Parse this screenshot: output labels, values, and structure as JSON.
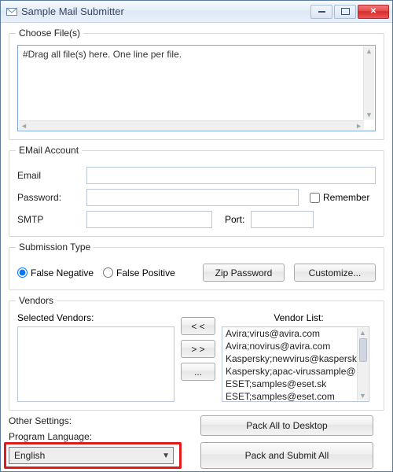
{
  "window": {
    "title": "Sample Mail Submitter"
  },
  "files": {
    "legend": "Choose File(s)",
    "placeholder": "#Drag all file(s) here. One line per file."
  },
  "email_account": {
    "legend": "EMail Account",
    "email_label": "Email",
    "password_label": "Password:",
    "remember_label": "Remember",
    "smtp_label": "SMTP",
    "port_label": "Port:",
    "email_value": "",
    "password_value": "",
    "smtp_value": "",
    "port_value": ""
  },
  "submission": {
    "legend": "Submission Type",
    "false_negative": "False Negative",
    "false_positive": "False Positive",
    "selected": "false_negative",
    "zip_password_btn": "Zip Password",
    "customize_btn": "Customize..."
  },
  "vendors": {
    "legend": "Vendors",
    "selected_label": "Selected Vendors:",
    "list_label": "Vendor List:",
    "move_left": "< <",
    "move_right": "> >",
    "more": "...",
    "selected_items": [],
    "list_items": [
      "Avira;virus@avira.com",
      "Avira;novirus@avira.com",
      "Kaspersky;newvirus@kaspersk",
      "Kaspersky;apac-virussample@",
      "ESET;samples@eset.sk",
      "ESET;samples@eset.com"
    ]
  },
  "other": {
    "legend": "Other Settings:",
    "lang_label": "Program Language:",
    "lang_value": "English"
  },
  "actions": {
    "pack_desktop": "Pack All to Desktop",
    "pack_submit": "Pack and Submit All"
  }
}
